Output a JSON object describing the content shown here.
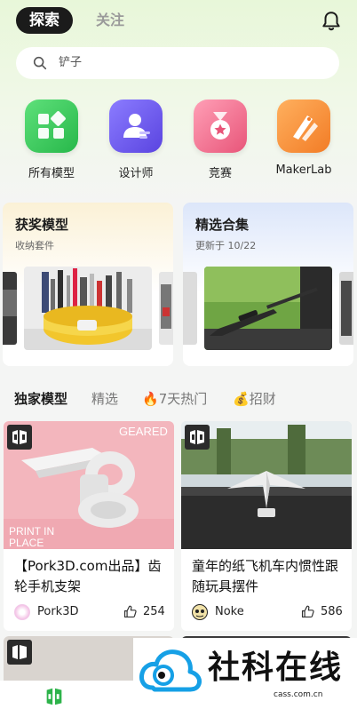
{
  "header": {
    "tab_active": "探索",
    "tab_inactive": "关注"
  },
  "search": {
    "placeholder": "铲子"
  },
  "categories": [
    {
      "label": "所有模型",
      "icon": "all-models-icon",
      "color": "#3ecb5b"
    },
    {
      "label": "设计师",
      "icon": "designer-icon",
      "color": "#6b5cf0"
    },
    {
      "label": "竞赛",
      "icon": "contest-medal-icon",
      "color": "#f06b8a"
    },
    {
      "label": "MakerLab",
      "icon": "makerlab-icon",
      "color": "#f7933c"
    }
  ],
  "features": [
    {
      "title": "获奖模型",
      "subtitle": "收纳套件"
    },
    {
      "title": "精选合集",
      "subtitle": "更新于 10/22"
    }
  ],
  "section_tabs": [
    "独家模型",
    "精选",
    "7天热门",
    "招财"
  ],
  "products": [
    {
      "image_text_top": "GEARED",
      "image_text_bottom": "PRINT IN PLACE",
      "title": "【Pork3D.com出品】齿轮手机支架",
      "author": "Pork3D",
      "likes": "254"
    },
    {
      "title": "童年的纸飞机车内惯性跟随玩具摆件",
      "author": "Noke",
      "likes": "586"
    }
  ],
  "watermark": {
    "brand": "社科在线",
    "url": "cass.com.cn"
  }
}
